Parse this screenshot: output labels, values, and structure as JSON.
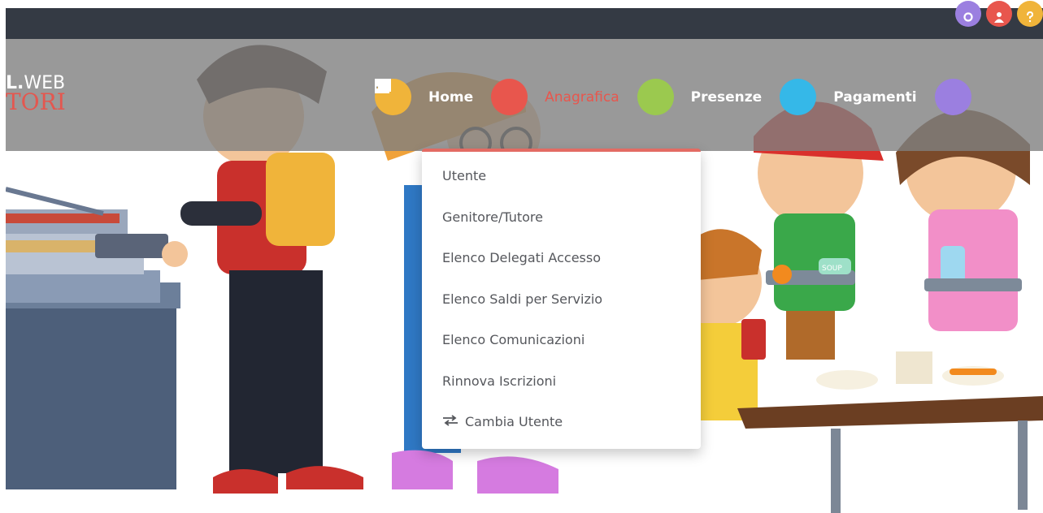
{
  "logo": {
    "line1_prefix": "L.",
    "line1_suffix": "WEB",
    "line2": "TORI"
  },
  "nav": {
    "items": [
      {
        "label": "Home",
        "icon": "home-icon",
        "color": "#f0b43a"
      },
      {
        "label": "Anagrafica",
        "icon": "user-icon",
        "color": "#e8564d",
        "active": true
      },
      {
        "label": "Presenze",
        "icon": "calendar-icon",
        "color": "#9bc94f"
      },
      {
        "label": "Pagamenti",
        "icon": "list-icon",
        "color": "#35b8e8"
      },
      {
        "label": "",
        "icon": "newspaper-icon",
        "color": "#9b7fe0"
      }
    ]
  },
  "dropdown": {
    "items": [
      {
        "label": "Utente"
      },
      {
        "label": "Genitore/Tutore"
      },
      {
        "label": "Elenco Delegati Accesso"
      },
      {
        "label": "Elenco Saldi per Servizio"
      },
      {
        "label": "Elenco Comunicazioni"
      },
      {
        "label": "Rinnova Iscrizioni"
      },
      {
        "label": "Cambia Utente",
        "icon": "exchange-icon"
      }
    ]
  },
  "top_icons": [
    {
      "icon": "settings-icon",
      "color": "#9b7fe0"
    },
    {
      "icon": "user-icon",
      "color": "#e8564d"
    },
    {
      "icon": "help-icon",
      "color": "#f0b43a"
    }
  ],
  "scene_text": {
    "soup_label": "SOUP"
  },
  "colors": {
    "topbar": "#343a44",
    "navbar_overlay": "#808080",
    "accent": "#e8564d",
    "dropdown_border": "#e36b63"
  }
}
